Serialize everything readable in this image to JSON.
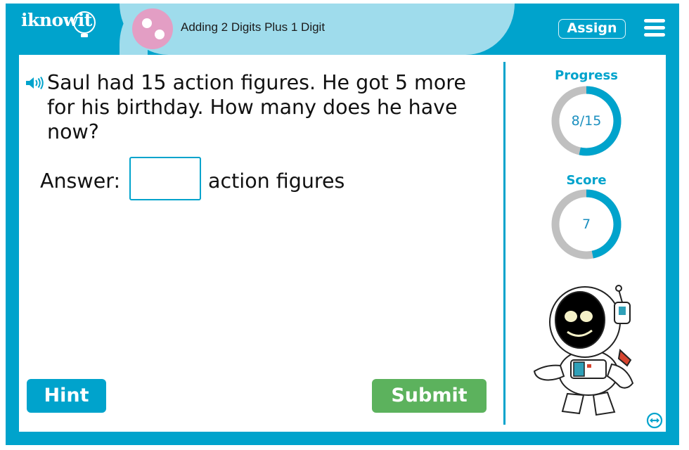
{
  "header": {
    "logo_text": "iknowit",
    "topic_title": "Adding 2 Digits Plus 1 Digit",
    "assign_label": "Assign",
    "menu_icon": "hamburger-menu-icon"
  },
  "question": {
    "audio_icon": "speaker-icon",
    "text": "Saul had 15 action figures. He got 5 more for his birthday. How many does he have now?",
    "answer_label": "Answer:",
    "answer_value": "",
    "answer_placeholder": "",
    "answer_unit": "action figures"
  },
  "buttons": {
    "hint_label": "Hint",
    "submit_label": "Submit"
  },
  "sidebar": {
    "progress": {
      "title": "Progress",
      "text": "8/15",
      "current": 8,
      "total": 15,
      "fraction": 0.533
    },
    "score": {
      "title": "Score",
      "text": "7",
      "fraction": 0.467
    },
    "mascot": "astronaut-mascot",
    "expand_icon": "expand-arrows-icon"
  },
  "colors": {
    "brand_blue": "#00a3cc",
    "header_light": "#9fdcec",
    "topic_pink": "#e39ec4",
    "submit_green": "#5cb25d",
    "ring_gray": "#c0c0c0"
  }
}
